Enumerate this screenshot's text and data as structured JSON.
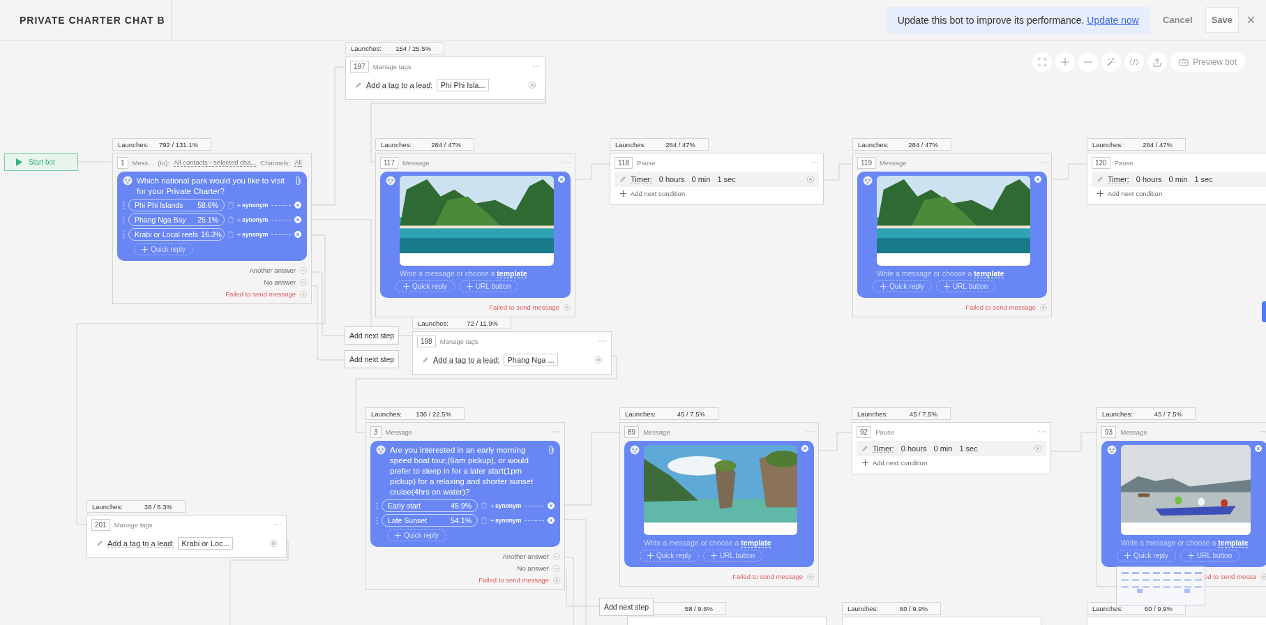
{
  "header": {
    "title": "PRIVATE CHARTER CHAT B"
  },
  "notice": {
    "text": "Update this bot to improve its performance.",
    "link": "Update now"
  },
  "actions": [
    {
      "label": "Cancel",
      "kind": "cancel"
    },
    {
      "label": "Save",
      "kind": "save"
    }
  ],
  "toolbar": {
    "preview": "Preview bot"
  },
  "start": {
    "label": "Start bot"
  },
  "nodes": [
    {
      "kind": "tags",
      "number": "197",
      "type": "Manage tags",
      "launches": {
        "label": "Launches:",
        "count": "154 / 25.5%"
      },
      "action": "Add a tag to a lead:",
      "tag": "Phi Phi Isla..."
    },
    {
      "kind": "question",
      "number": "1",
      "type": "Mess...",
      "launches": {
        "label": "Launches:",
        "count": "792 / 131.1%"
      },
      "recipient_label": "(to):",
      "recipient": "All contacts - selected cha...",
      "channels_label": "Channels:",
      "channels": "All",
      "question": "Which national park would you like to visit for your Private Charter?",
      "replies": [
        {
          "label": "Phi Phi Islands",
          "share": "58.6%",
          "synonym": "synonym"
        },
        {
          "label": "Phang Nga Bay",
          "share": "25.1%",
          "synonym": "synonym"
        },
        {
          "label": "Krabi or Local reefs",
          "share": "16.3%",
          "synonym": "synonym"
        }
      ],
      "add_reply": "Quick reply",
      "outputs": [
        {
          "label": "Another answer",
          "kind": "other"
        },
        {
          "label": "No answer",
          "kind": "other"
        },
        {
          "label": "Failed to send message",
          "kind": "failed"
        }
      ]
    },
    {
      "number": "117",
      "type": "Message",
      "launches": {
        "label": "Launches:",
        "count": "284 / 47%"
      },
      "prompt": "Write a message or choose a",
      "link": "template",
      "buttons": [
        "Quick reply",
        "URL button"
      ],
      "outputs": [
        {
          "label": "Failed to send message",
          "kind": "failed"
        }
      ]
    },
    {
      "kind": "pause",
      "number": "118",
      "type": "Pause",
      "launches": {
        "label": "Launches:",
        "count": "284 / 47%"
      },
      "timer_label": "Timer:",
      "timer": [
        {
          "value": "0",
          "unit": "hours"
        },
        {
          "value": "0",
          "unit": "min"
        },
        {
          "value": "1",
          "unit": "sec"
        }
      ],
      "add_condition": "Add next condition"
    },
    {
      "number": "119",
      "type": "Message",
      "launches": {
        "label": "Launches:",
        "count": "284 / 47%"
      },
      "prompt": "Write a message or choose a",
      "link": "template",
      "buttons": [
        "Quick reply",
        "URL button"
      ],
      "outputs": [
        {
          "label": "Failed to send message",
          "kind": "failed"
        }
      ]
    },
    {
      "kind": "pause",
      "number": "120",
      "type": "Pause",
      "launches": {
        "label": "Launches:",
        "count": "284 / 47%"
      },
      "timer_label": "Timer:",
      "timer": [
        {
          "value": "0",
          "unit": "hours"
        },
        {
          "value": "0",
          "unit": "min"
        },
        {
          "value": "1",
          "unit": "sec"
        }
      ],
      "add_condition": "Add next condition"
    },
    {
      "kind": "tags",
      "number": "198",
      "type": "Manage tags",
      "launches": {
        "label": "Launches:",
        "count": "72 / 11.9%"
      },
      "action": "Add a tag to a lead:",
      "tag": "Phang Nga ..."
    },
    {
      "kind": "question",
      "number": "3",
      "type": "Message",
      "launches": {
        "label": "Launches:",
        "count": "136 / 22.5%"
      },
      "question": "Are you interested in an early morning speed boat tour,(6am pickup), or would prefer to sleep in for a later start(1pm pickup) for a relaxing and shorter sunset cruise(4hrs on water)?",
      "replies": [
        {
          "label": "Early start",
          "share": "45.9%",
          "synonym": "synonym"
        },
        {
          "label": "Late Sunset",
          "share": "54.1%",
          "synonym": "synonym"
        }
      ],
      "add_reply": "Quick reply",
      "outputs": [
        {
          "label": "Another answer",
          "kind": "other"
        },
        {
          "label": "No answer",
          "kind": "other"
        },
        {
          "label": "Failed to send message",
          "kind": "failed"
        }
      ]
    },
    {
      "kind": "tags",
      "number": "201",
      "type": "Manage tags",
      "launches": {
        "label": "Launches:",
        "count": "38 / 6.3%"
      },
      "action": "Add a tag to a lead:",
      "tag": "Krabi or Loc..."
    },
    {
      "number": "89",
      "type": "Message",
      "launches": {
        "label": "Launches:",
        "count": "45 / 7.5%"
      },
      "prompt": "Write a message or choose a",
      "link": "template",
      "buttons": [
        "Quick reply",
        "URL button"
      ],
      "outputs": [
        {
          "label": "Failed to send message",
          "kind": "failed"
        }
      ]
    },
    {
      "kind": "pause",
      "number": "92",
      "type": "Pause",
      "launches": {
        "label": "Launches:",
        "count": "45 / 7.5%"
      },
      "timer_label": "Timer:",
      "timer": [
        {
          "value": "0",
          "unit": "hours"
        },
        {
          "value": "0",
          "unit": "min"
        },
        {
          "value": "1",
          "unit": "sec"
        }
      ],
      "add_condition": "Add next condition"
    },
    {
      "number": "93",
      "type": "Message",
      "launches": {
        "label": "Launches:",
        "count": "45 / 7.5%"
      },
      "prompt": "Write a message or choose a",
      "link": "template",
      "buttons": [
        "Quick reply",
        "URL button"
      ],
      "outputs": [
        {
          "label": "Failed to send messa",
          "kind": "failed"
        }
      ]
    }
  ],
  "add_next_step": [
    {
      "label": "Add next step"
    },
    {
      "label": "Add next step"
    },
    {
      "label": "Add next step"
    }
  ],
  "pending_launches": [
    {
      "count": "58 / 9.6%"
    },
    {
      "label": "Launches:",
      "count": "60 / 9.9%"
    },
    {
      "label": "Launches:",
      "count": "60 / 9.9%"
    }
  ]
}
